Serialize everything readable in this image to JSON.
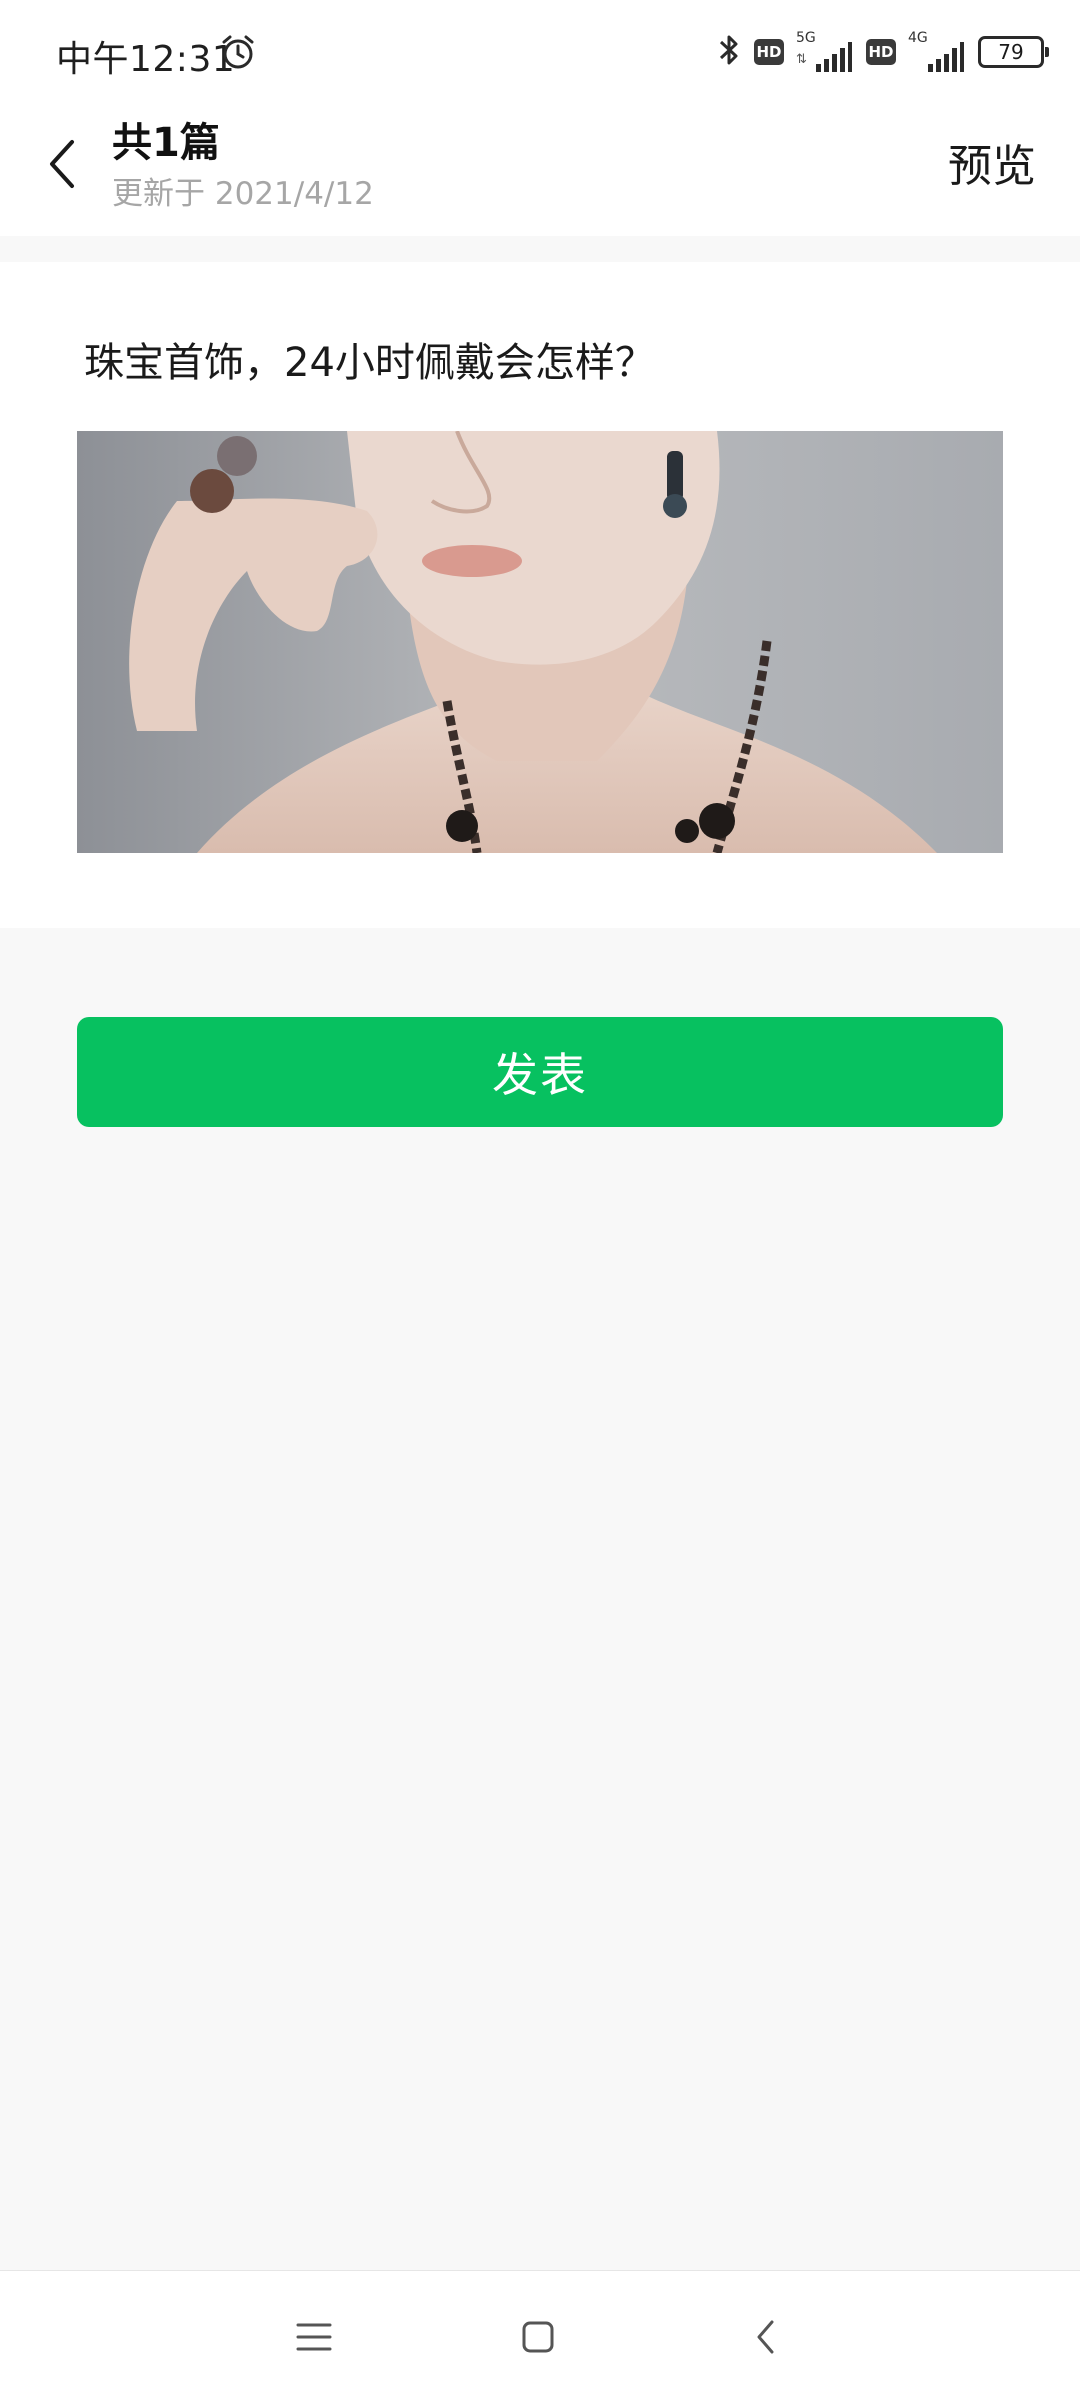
{
  "status_bar": {
    "time": "中午12:31",
    "net1_label": "5G",
    "net1_arrows": "⇅",
    "net2_label": "4G",
    "hd_label": "HD",
    "battery": "79"
  },
  "header": {
    "title": "共1篇",
    "subtitle": "更新于 2021/4/12",
    "preview_label": "预览"
  },
  "article": {
    "title": "珠宝首饰，24小时佩戴会怎样？"
  },
  "actions": {
    "publish_label": "发表"
  },
  "colors": {
    "accent_green": "#07c160",
    "subtitle_gray": "#a6a6a6",
    "background": "#f8f8f8"
  },
  "icons": {
    "status": [
      "alarm-icon",
      "bluetooth-icon",
      "signal-icon",
      "battery-icon"
    ],
    "header": [
      "back-arrow-icon"
    ],
    "nav": [
      "menu-icon",
      "home-square-icon",
      "back-chevron-icon"
    ]
  }
}
